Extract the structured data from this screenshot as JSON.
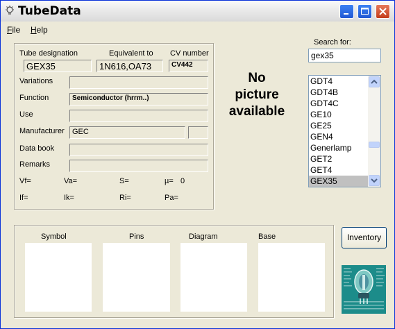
{
  "window": {
    "title": "TubeData"
  },
  "menu": {
    "file": "ile",
    "file_acc": "F",
    "help": "elp",
    "help_acc": "H"
  },
  "tube": {
    "labels": {
      "designation": "Tube designation",
      "equivalent": "Equivalent to",
      "cv": "CV number",
      "variations": "Variations",
      "function": "Function",
      "use": "Use",
      "manufacturer": "Manufacturer",
      "databook": "Data book",
      "remarks": "Remarks"
    },
    "designation": "GEX35",
    "equivalent": "1N616,OA73",
    "cv": "CV442",
    "variations": "",
    "function": "Semiconductor (hrrm..)",
    "use": "",
    "manufacturer": "GEC",
    "manufacturer_code": "",
    "databook": "",
    "remarks": ""
  },
  "params": {
    "vf": "Vf=",
    "va": "Va=",
    "s": "S=",
    "mu": "µ=",
    "mu_val": "0",
    "if": "If=",
    "ik": "Ik=",
    "ri": "Ri=",
    "pa": "Pa="
  },
  "picture": {
    "line1": "No",
    "line2": "picture",
    "line3": "available"
  },
  "search": {
    "label": "Search for:",
    "value": "gex35"
  },
  "list": {
    "items": [
      "GDT4",
      "GDT4B",
      "GDT4C",
      "GE10",
      "GE25",
      "GEN4",
      "Generlamp",
      "GET2",
      "GET4",
      "GEX35"
    ],
    "selected": "GEX35"
  },
  "panels": {
    "symbol": "Symbol",
    "pins": "Pins",
    "diagram": "Diagram",
    "base": "Base"
  },
  "buttons": {
    "inventory": "Inventory"
  },
  "colors": {
    "title_bar": "#d9d9d9",
    "window_bg": "#ece9d8",
    "selected_row": "#c0c0c0",
    "logo_bg": "#1c8c8a"
  }
}
